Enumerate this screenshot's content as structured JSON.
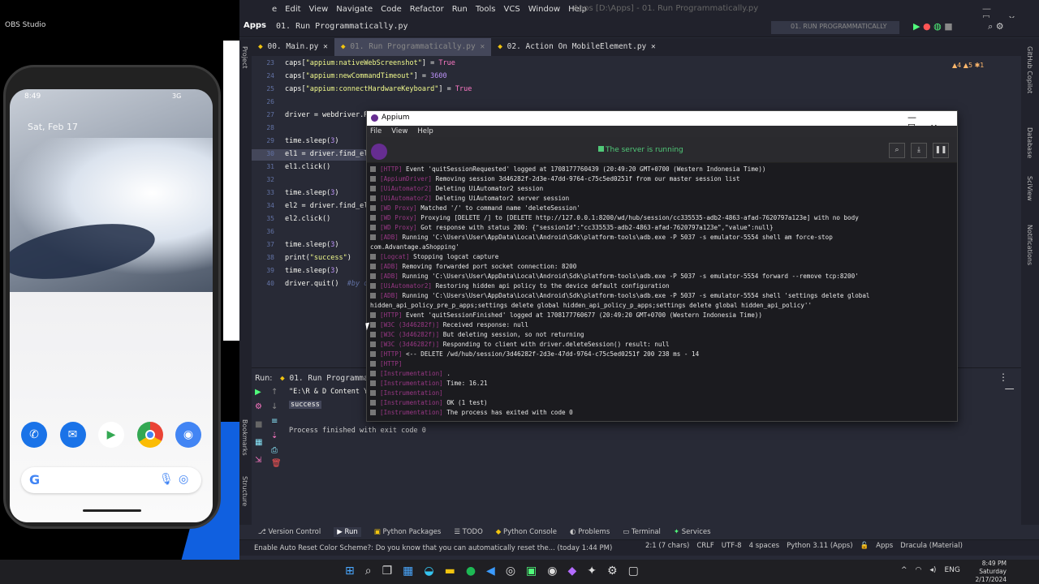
{
  "obs": {
    "title": "OBS Studio"
  },
  "phone": {
    "time": "8:49",
    "network": "3G",
    "date": "Sat, Feb 17",
    "dock_apps": [
      "phone-icon",
      "messages-icon",
      "play-store-icon",
      "chrome-icon",
      "camera-icon"
    ],
    "search_logo": "G"
  },
  "ide": {
    "menu": [
      "e",
      "Edit",
      "View",
      "Navigate",
      "Code",
      "Refactor",
      "Run",
      "Tools",
      "VCS",
      "Window",
      "Help"
    ],
    "window_title": "Apps [D:\\Apps] - 01. Run Programmatically.py",
    "project": "Apps",
    "breadcrumb": "01. Run Programmatically.py",
    "run_config": "01. RUN PROGRAMMATICALLY",
    "tabs": [
      {
        "label": "00. Main.py",
        "active": false
      },
      {
        "label": "01. Run Programmatically.py",
        "active": true
      },
      {
        "label": "02. Action On MobileElement.py",
        "active": false
      }
    ],
    "warnings": "▲4 ▲5 ✱1",
    "left_strip": {
      "project": "Project",
      "bookmarks": "Bookmarks",
      "structure": "Structure"
    },
    "right_strip": {
      "copilot": "GitHub Copilot",
      "database": "Database",
      "sciview": "SciView",
      "notifications": "Notifications"
    },
    "lines": [
      {
        "n": "23",
        "code": "caps[\"appium:nativeWebScreenshot\"] = True"
      },
      {
        "n": "24",
        "code": "caps[\"appium:newCommandTimeout\"] = 3600"
      },
      {
        "n": "25",
        "code": "caps[\"appium:connectHardwareKeyboard\"] = True"
      },
      {
        "n": "26",
        "code": ""
      },
      {
        "n": "27",
        "code": "driver = webdriver.Re"
      },
      {
        "n": "28",
        "code": ""
      },
      {
        "n": "29",
        "code": "time.sleep(3)"
      },
      {
        "n": "30",
        "code": "el1 = driver.find_ele"
      },
      {
        "n": "31",
        "code": "el1.click()"
      },
      {
        "n": "32",
        "code": ""
      },
      {
        "n": "33",
        "code": "time.sleep(3)"
      },
      {
        "n": "34",
        "code": "el2 = driver.find_ele"
      },
      {
        "n": "35",
        "code": "el2.click()"
      },
      {
        "n": "36",
        "code": ""
      },
      {
        "n": "37",
        "code": "time.sleep(3)"
      },
      {
        "n": "38",
        "code": "print(\"success\")"
      },
      {
        "n": "39",
        "code": "time.sleep(3)"
      },
      {
        "n": "40",
        "code": "driver.quit()  #by def"
      }
    ],
    "run": {
      "label": "Run:",
      "tab": "01. Run Programmatic",
      "cmd": "\"E:\\R & D Content Yo",
      "success": "success",
      "finished": "Process finished with exit code 0"
    },
    "tool_tabs": [
      "Version Control",
      "Run",
      "Python Packages",
      "TODO",
      "Python Console",
      "Problems",
      "Terminal",
      "Services"
    ],
    "status": {
      "message": "Enable Auto Reset Color Scheme?: Do you know that you can automatically reset the... (today 1:44 PM)",
      "pos": "2:1 (7 chars)",
      "eol": "CRLF",
      "enc": "UTF-8",
      "indent": "4 spaces",
      "interp": "Python 3.11 (Apps)",
      "project": "Apps",
      "theme": "Dracula (Material)"
    }
  },
  "appium": {
    "title": "Appium",
    "menu": [
      "File",
      "View",
      "Help"
    ],
    "status": "The server is running",
    "logs": [
      {
        "tag": "[HTTP]",
        "text": "Event 'quitSessionRequested' logged at 1708177760439 (20:49:20 GMT+0700 (Western Indonesia Time))"
      },
      {
        "tag": "[AppiumDriver]",
        "text": "Removing session 3d46282f-2d3e-47dd-9764-c75c5ed0251f from our master session list"
      },
      {
        "tag": "[UiAutomator2]",
        "text": "Deleting UiAutomator2 session"
      },
      {
        "tag": "[UiAutomator2]",
        "text": "Deleting UiAutomator2 server session"
      },
      {
        "tag": "[WD Proxy]",
        "text": "Matched '/' to command name 'deleteSession'"
      },
      {
        "tag": "[WD Proxy]",
        "text": "Proxying [DELETE /] to [DELETE http://127.0.0.1:8200/wd/hub/session/cc335535-adb2-4863-afad-7620797a123e] with no body"
      },
      {
        "tag": "[WD Proxy]",
        "text": "Got response with status 200: {\"sessionId\":\"cc335535-adb2-4863-afad-7620797a123e\",\"value\":null}"
      },
      {
        "tag": "[ADB]",
        "text": "Running 'C:\\Users\\User\\AppData\\Local\\Android\\Sdk\\platform-tools\\adb.exe -P 5037 -s emulator-5554 shell am force-stop"
      },
      {
        "tag": "",
        "text": "com.Advantage.aShopping'"
      },
      {
        "tag": "[Logcat]",
        "text": "Stopping logcat capture"
      },
      {
        "tag": "[ADB]",
        "text": "Removing forwarded port socket connection: 8200"
      },
      {
        "tag": "[ADB]",
        "text": "Running 'C:\\Users\\User\\AppData\\Local\\Android\\Sdk\\platform-tools\\adb.exe -P 5037 -s emulator-5554 forward --remove tcp:8200'"
      },
      {
        "tag": "[UiAutomator2]",
        "text": "Restoring hidden api policy to the device default configuration"
      },
      {
        "tag": "[ADB]",
        "text": "Running 'C:\\Users\\User\\AppData\\Local\\Android\\Sdk\\platform-tools\\adb.exe -P 5037 -s emulator-5554 shell 'settings delete global"
      },
      {
        "tag": "",
        "text": "hidden_api_policy_pre_p_apps;settings delete global hidden_api_policy_p_apps;settings delete global hidden_api_policy''"
      },
      {
        "tag": "[HTTP]",
        "text": "Event 'quitSessionFinished' logged at 1708177760677 (20:49:20 GMT+0700 (Western Indonesia Time))"
      },
      {
        "tag": "[W3C (3d46282f)]",
        "text": "Received response: null"
      },
      {
        "tag": "[W3C (3d46282f)]",
        "text": "But deleting session, so not returning"
      },
      {
        "tag": "[W3C (3d46282f)]",
        "text": "Responding to client with driver.deleteSession() result: null"
      },
      {
        "tag": "[HTTP]",
        "text": "<-- DELETE /wd/hub/session/3d46282f-2d3e-47dd-9764-c75c5ed0251f 200 238 ms - 14"
      },
      {
        "tag": "[HTTP]",
        "text": ""
      },
      {
        "tag": "[Instrumentation]",
        "text": "."
      },
      {
        "tag": "[Instrumentation]",
        "text": "Time: 16.21"
      },
      {
        "tag": "[Instrumentation]",
        "text": ""
      },
      {
        "tag": "[Instrumentation]",
        "text": "OK (1 test)"
      },
      {
        "tag": "[Instrumentation]",
        "text": "The process has exited with code 0"
      }
    ]
  },
  "taskbar": {
    "tray": [
      "^",
      "ENG"
    ],
    "time": "8:49 PM",
    "day": "Saturday",
    "date": "2/17/2024"
  }
}
